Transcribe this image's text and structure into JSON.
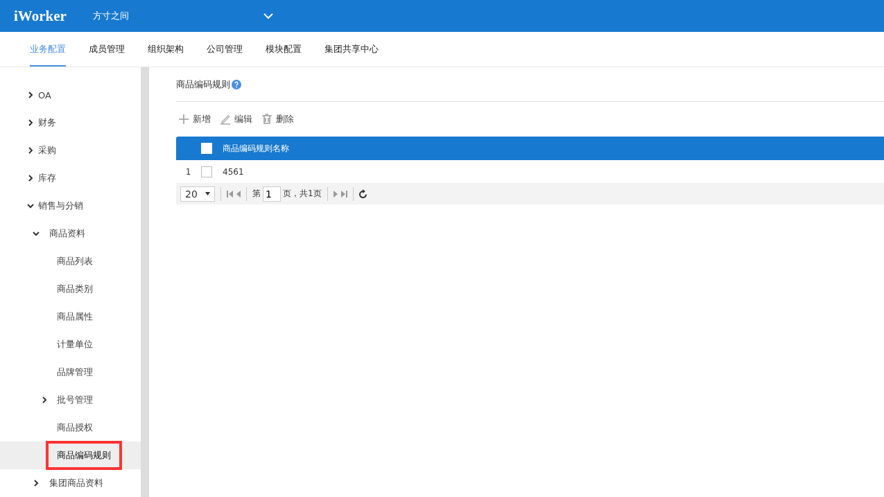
{
  "header": {
    "logo": "iWorker",
    "company": "方寸之间"
  },
  "nav_tabs": [
    {
      "label": "业务配置",
      "selected": true
    },
    {
      "label": "成员管理",
      "selected": false
    },
    {
      "label": "组织架构",
      "selected": false
    },
    {
      "label": "公司管理",
      "selected": false
    },
    {
      "label": "模块配置",
      "selected": false
    },
    {
      "label": "集团共享中心",
      "selected": false
    }
  ],
  "sidebar": {
    "items": [
      {
        "label": "OA",
        "expanded": false,
        "selected": false,
        "highlighted": false
      },
      {
        "label": "财务",
        "expanded": false,
        "selected": false,
        "highlighted": false
      },
      {
        "label": "采购",
        "expanded": false,
        "selected": false,
        "highlighted": false
      },
      {
        "label": "库存",
        "expanded": false,
        "selected": false,
        "highlighted": false
      },
      {
        "label": "销售与分销",
        "expanded": true,
        "selected": false,
        "highlighted": false,
        "children": [
          {
            "label": "商品资料",
            "expanded": true,
            "selected": false,
            "highlighted": false,
            "children": [
              {
                "label": "商品列表",
                "selected": false,
                "highlighted": false
              },
              {
                "label": "商品类别",
                "selected": false,
                "highlighted": false
              },
              {
                "label": "商品属性",
                "selected": false,
                "highlighted": false
              },
              {
                "label": "计量单位",
                "selected": false,
                "highlighted": false
              },
              {
                "label": "品牌管理",
                "selected": false,
                "highlighted": false
              },
              {
                "label": "批号管理",
                "expanded": false,
                "selected": false,
                "highlighted": false
              },
              {
                "label": "商品授权",
                "selected": false,
                "highlighted": false
              },
              {
                "label": "商品编码规则",
                "selected": true,
                "highlighted": true
              }
            ]
          },
          {
            "label": "集团商品资料",
            "expanded": false,
            "selected": false,
            "highlighted": false
          }
        ]
      }
    ]
  },
  "page": {
    "title": "商品编码规则",
    "toolbar": [
      {
        "kind": "add",
        "label": "新增"
      },
      {
        "kind": "edit",
        "label": "编辑"
      },
      {
        "kind": "delete",
        "label": "删除"
      }
    ],
    "table": {
      "all_checked": false,
      "columns": [
        "商品编码规则名称"
      ],
      "rows": [
        {
          "index": "1",
          "checked": false,
          "cells": [
            "4561"
          ]
        }
      ]
    },
    "pager": {
      "page_size": "20",
      "page_prefix": "第",
      "page": "1",
      "page_suffix": "页，共1页"
    }
  }
}
